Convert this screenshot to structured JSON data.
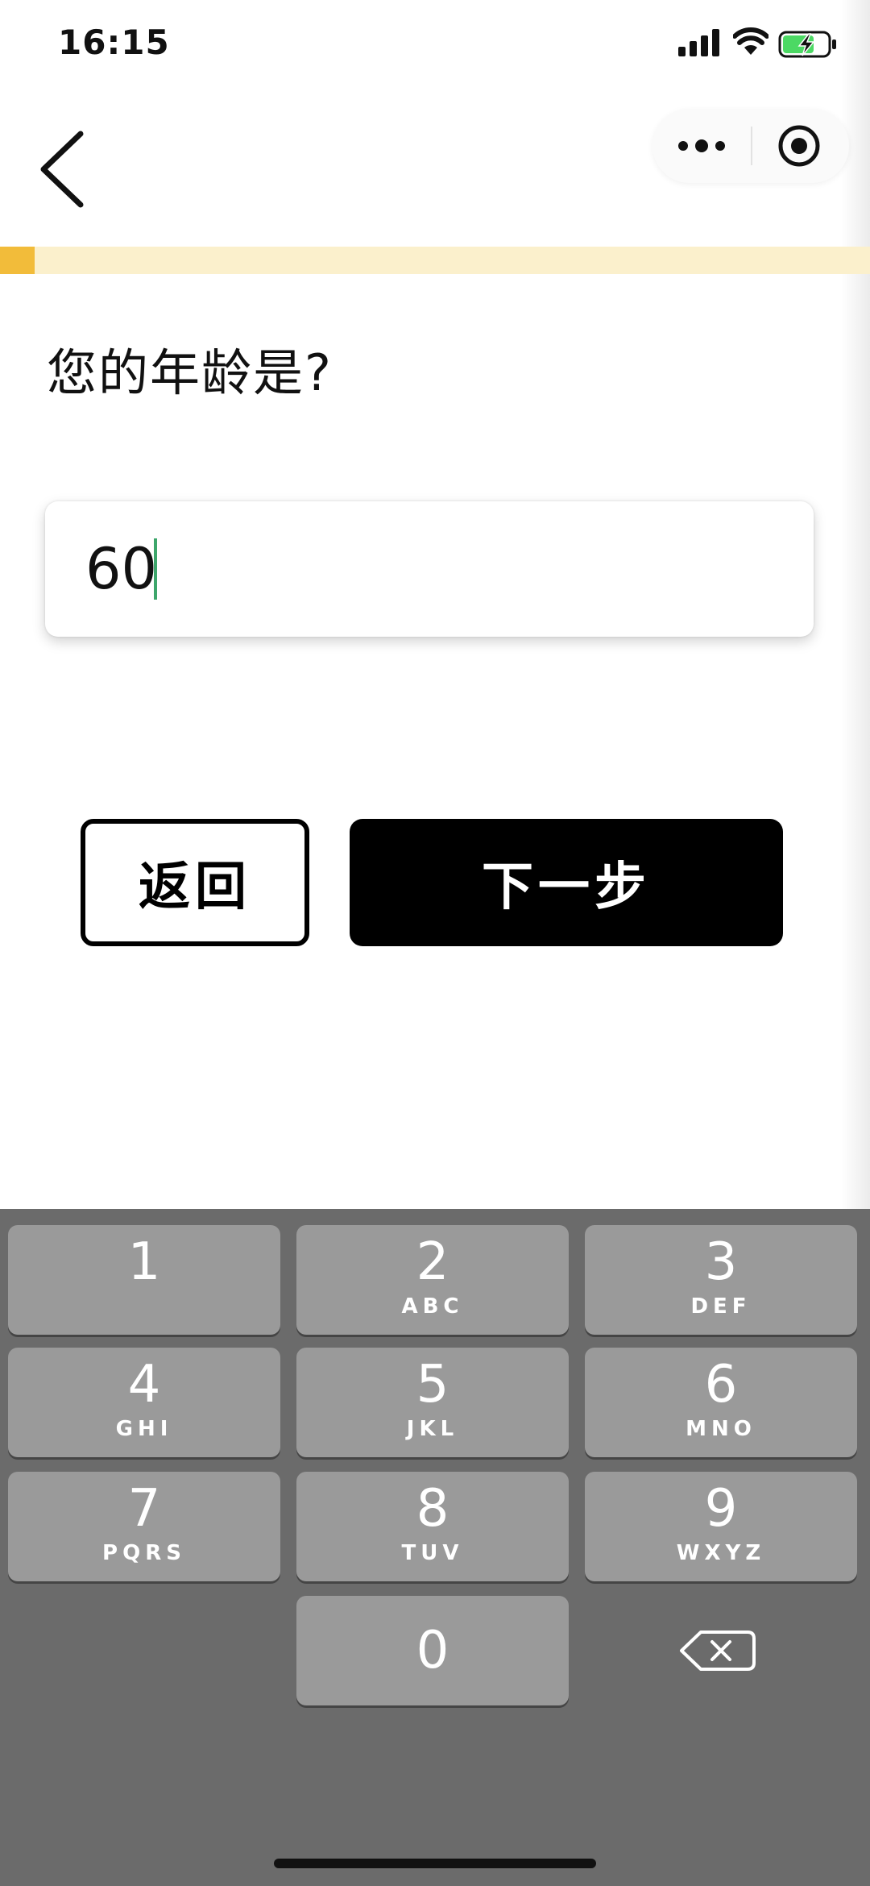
{
  "status_bar": {
    "time": "16:15"
  },
  "nav": {
    "back_icon": "chevron-left-icon",
    "more_icon": "more-dots-icon",
    "close_icon": "target-close-icon"
  },
  "progress": {
    "value": 0.04,
    "fill_color": "#f2bc3a",
    "track_color": "#fbf0cc"
  },
  "question": {
    "title": "您的年龄是?"
  },
  "age_input": {
    "value": "60"
  },
  "buttons": {
    "back_label": "返回",
    "next_label": "下一步"
  },
  "keyboard": {
    "keys": [
      {
        "digit": "1",
        "letters": ""
      },
      {
        "digit": "2",
        "letters": "ABC"
      },
      {
        "digit": "3",
        "letters": "DEF"
      },
      {
        "digit": "4",
        "letters": "GHI"
      },
      {
        "digit": "5",
        "letters": "JKL"
      },
      {
        "digit": "6",
        "letters": "MNO"
      },
      {
        "digit": "7",
        "letters": "PQRS"
      },
      {
        "digit": "8",
        "letters": "TUV"
      },
      {
        "digit": "9",
        "letters": "WXYZ"
      },
      {
        "digit": "0",
        "letters": ""
      }
    ],
    "delete_icon": "backspace-icon"
  }
}
